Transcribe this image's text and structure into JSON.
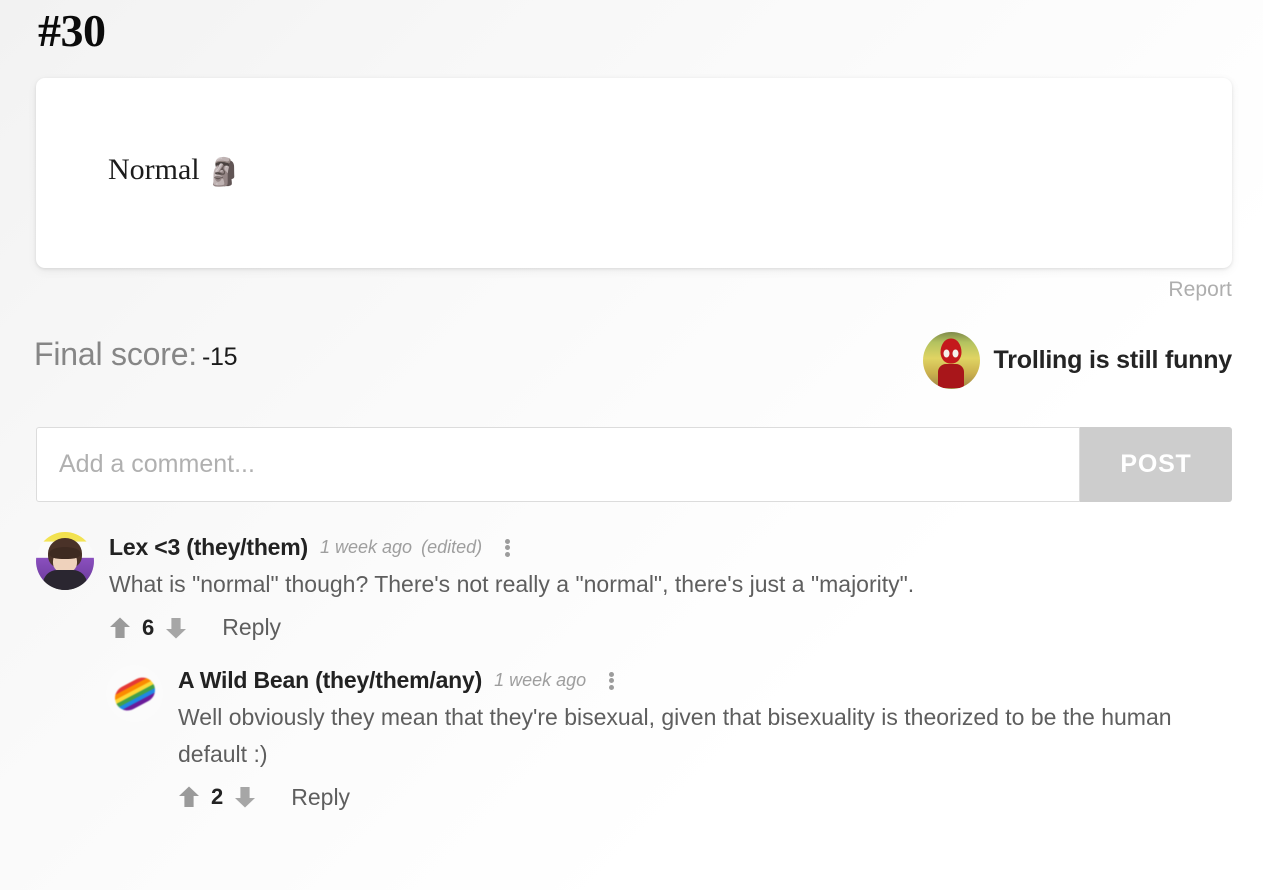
{
  "post": {
    "number": "#30",
    "card_text": "Normal ",
    "card_emoji": "🗿",
    "report_label": "Report",
    "score_label": "Final score:",
    "score_value": "-15",
    "author_name": "Trolling is still funny"
  },
  "composer": {
    "placeholder": "Add a comment...",
    "value": "",
    "post_label": "POST"
  },
  "comments": [
    {
      "author": "Lex <3 (they/them)",
      "time": "1 week ago",
      "edited": "(edited)",
      "text": "What is \"normal\" though? There's not really a \"normal\", there's just a \"majority\".",
      "votes": "6",
      "reply_label": "Reply"
    },
    {
      "author": "A Wild Bean (they/them/any)",
      "time": "1 week ago",
      "edited": "",
      "text": "Well obviously they mean that they're bisexual, given that bisexuality is theorized to be the human default :)",
      "votes": "2",
      "reply_label": "Reply"
    }
  ],
  "colors": {
    "page_background": "#f7f7f7",
    "card_background": "#ffffff",
    "muted_text": "#9e9e9e",
    "body_text": "#5e5e5e",
    "post_button": "#cdcdcd",
    "arrow": "#9a9a9a"
  }
}
